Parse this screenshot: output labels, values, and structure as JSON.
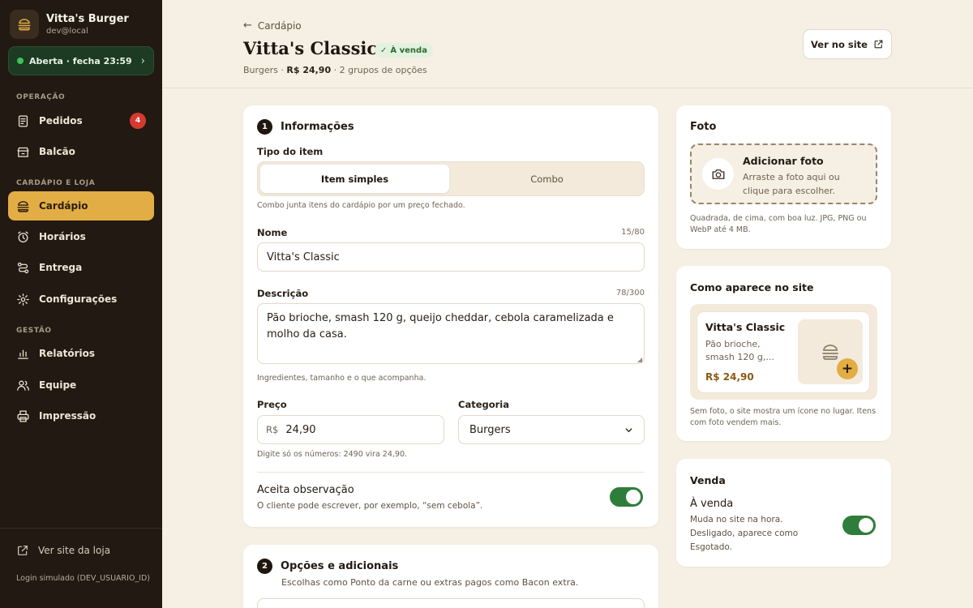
{
  "brand": {
    "name": "Vitta's Burger",
    "user": "dev@local"
  },
  "status": {
    "label": "Aberta · fecha 23:59",
    "color": "#3fc25a"
  },
  "nav": {
    "section_operacao": "OPERAÇÃO",
    "section_cardapio": "CARDÁPIO E LOJA",
    "section_gestao": "GESTÃO",
    "items": [
      {
        "label": "Pedidos",
        "badge": "4"
      },
      {
        "label": "Balcão"
      },
      {
        "label": "Cardápio",
        "active": true
      },
      {
        "label": "Horários"
      },
      {
        "label": "Entrega"
      },
      {
        "label": "Configurações"
      },
      {
        "label": "Relatórios"
      },
      {
        "label": "Equipe"
      },
      {
        "label": "Impressão"
      }
    ]
  },
  "sidebar_footer": {
    "link": "Ver site da loja",
    "login_note": "Login simulado (DEV_USUARIO_ID)"
  },
  "header": {
    "back_label": "Cardápio",
    "title": "Vitta's Classic",
    "badge": "À venda",
    "meta_category": "Burgers",
    "meta_price": "R$ 24,90",
    "meta_groups": "2 grupos de opções",
    "view_site": "Ver no site"
  },
  "info": {
    "step": "1",
    "title": "Informações",
    "type_label": "Tipo do item",
    "type_options": [
      "Item simples",
      "Combo"
    ],
    "type_hint": "Combo junta itens do cardápio por um preço fechado.",
    "name_label": "Nome",
    "name_counter": "15/80",
    "name_value": "Vitta's Classic",
    "desc_label": "Descrição",
    "desc_counter": "78/300",
    "desc_value": "Pão brioche, smash 120 g, queijo cheddar, cebola caramelizada e molho da casa.",
    "desc_hint": "Ingredientes, tamanho e o que acompanha.",
    "price_label": "Preço",
    "price_prefix": "R$",
    "price_value": "24,90",
    "price_hint": "Digite só os números: 2490 vira 24,90.",
    "category_label": "Categoria",
    "category_value": "Burgers",
    "obs_title": "Aceita observação",
    "obs_hint": "O cliente pode escrever, por exemplo, “sem cebola”.",
    "obs_enabled": true
  },
  "options": {
    "step": "2",
    "title": "Opções e adicionais",
    "subtitle": "Escolhas como Ponto da carne ou extras pagos como Bacon extra."
  },
  "photo": {
    "title": "Foto",
    "add_title": "Adicionar foto",
    "add_hint": "Arraste a foto aqui ou clique para escolher.",
    "note": "Quadrada, de cima, com boa luz. JPG, PNG ou WebP até 4 MB."
  },
  "preview": {
    "title": "Como aparece no site",
    "item_name": "Vitta's Classic",
    "item_desc": "Pão brioche, smash 120 g,...",
    "item_price": "R$ 24,90",
    "note": "Sem foto, o site mostra um ícone no lugar. Itens com foto vendem mais."
  },
  "sale": {
    "title": "Venda",
    "label": "À venda",
    "hint": "Muda no site na hora. Desligado, aparece como Esgotado.",
    "enabled": true
  },
  "colors": {
    "accent": "#e2ad45",
    "sidebar": "#211912",
    "success": "#2f7d3a",
    "badge": "#d53a2f"
  }
}
